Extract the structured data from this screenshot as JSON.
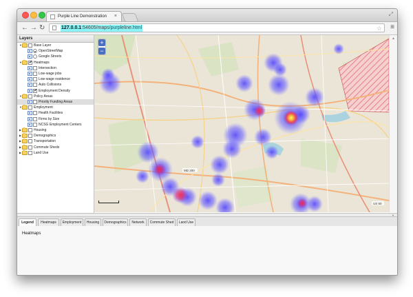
{
  "browser": {
    "tab_title": "Purple Line Demonstration",
    "tab_close": "×",
    "url_host": "127.0.0.1",
    "url_rest": ":54605/maps/purpleline.html"
  },
  "layers": {
    "header": "Layers",
    "items": [
      {
        "label": "Base Layer",
        "type": "folder",
        "level": 0,
        "expanded": true,
        "checked": false
      },
      {
        "label": "OpenStreetMap",
        "type": "radio",
        "level": 1,
        "checked": true
      },
      {
        "label": "Google Streets",
        "type": "radio",
        "level": 1,
        "checked": false
      },
      {
        "label": "Heatmaps",
        "type": "folder",
        "level": 0,
        "expanded": true,
        "checked": true
      },
      {
        "label": "Intersection",
        "type": "leaf",
        "level": 1,
        "checked": false
      },
      {
        "label": "Low-wage jobs",
        "type": "leaf",
        "level": 1,
        "checked": false
      },
      {
        "label": "Low-wage residence",
        "type": "leaf",
        "level": 1,
        "checked": false
      },
      {
        "label": "Auto Collisions",
        "type": "leaf",
        "level": 1,
        "checked": false
      },
      {
        "label": "Employment Density",
        "type": "leaf",
        "level": 1,
        "checked": true
      },
      {
        "label": "Policy Areas",
        "type": "folder",
        "level": 0,
        "expanded": true,
        "checked": false
      },
      {
        "label": "Priority Funding Areas",
        "type": "leaf",
        "level": 1,
        "checked": false,
        "selected": true
      },
      {
        "label": "Employment",
        "type": "folder",
        "level": 0,
        "expanded": true,
        "checked": false
      },
      {
        "label": "Health Facilities",
        "type": "leaf",
        "level": 1,
        "checked": false
      },
      {
        "label": "Firms by Size",
        "type": "leaf",
        "level": 1,
        "checked": false
      },
      {
        "label": "NCSG Employment Centers",
        "type": "leaf",
        "level": 1,
        "checked": false
      },
      {
        "label": "Housing",
        "type": "folder",
        "level": 0,
        "expanded": false,
        "checked": false
      },
      {
        "label": "Demographics",
        "type": "folder",
        "level": 0,
        "expanded": false,
        "checked": false
      },
      {
        "label": "Transportation",
        "type": "folder",
        "level": 0,
        "expanded": false,
        "checked": false
      },
      {
        "label": "Commute Sheds",
        "type": "folder",
        "level": 0,
        "expanded": false,
        "checked": false
      },
      {
        "label": "Land Use",
        "type": "folder",
        "level": 0,
        "expanded": false,
        "checked": false
      }
    ]
  },
  "map": {
    "zoom_in": "+",
    "zoom_out": "−",
    "road_labels": [
      "MD 200",
      "US 50"
    ]
  },
  "bottom_tabs": [
    "Legend",
    "Heatmaps",
    "Employment",
    "Housing",
    "Demographics",
    "Network",
    "Commute Shed",
    "Land Use"
  ],
  "active_tab": "Legend",
  "panel": {
    "title": "Heatmaps"
  }
}
